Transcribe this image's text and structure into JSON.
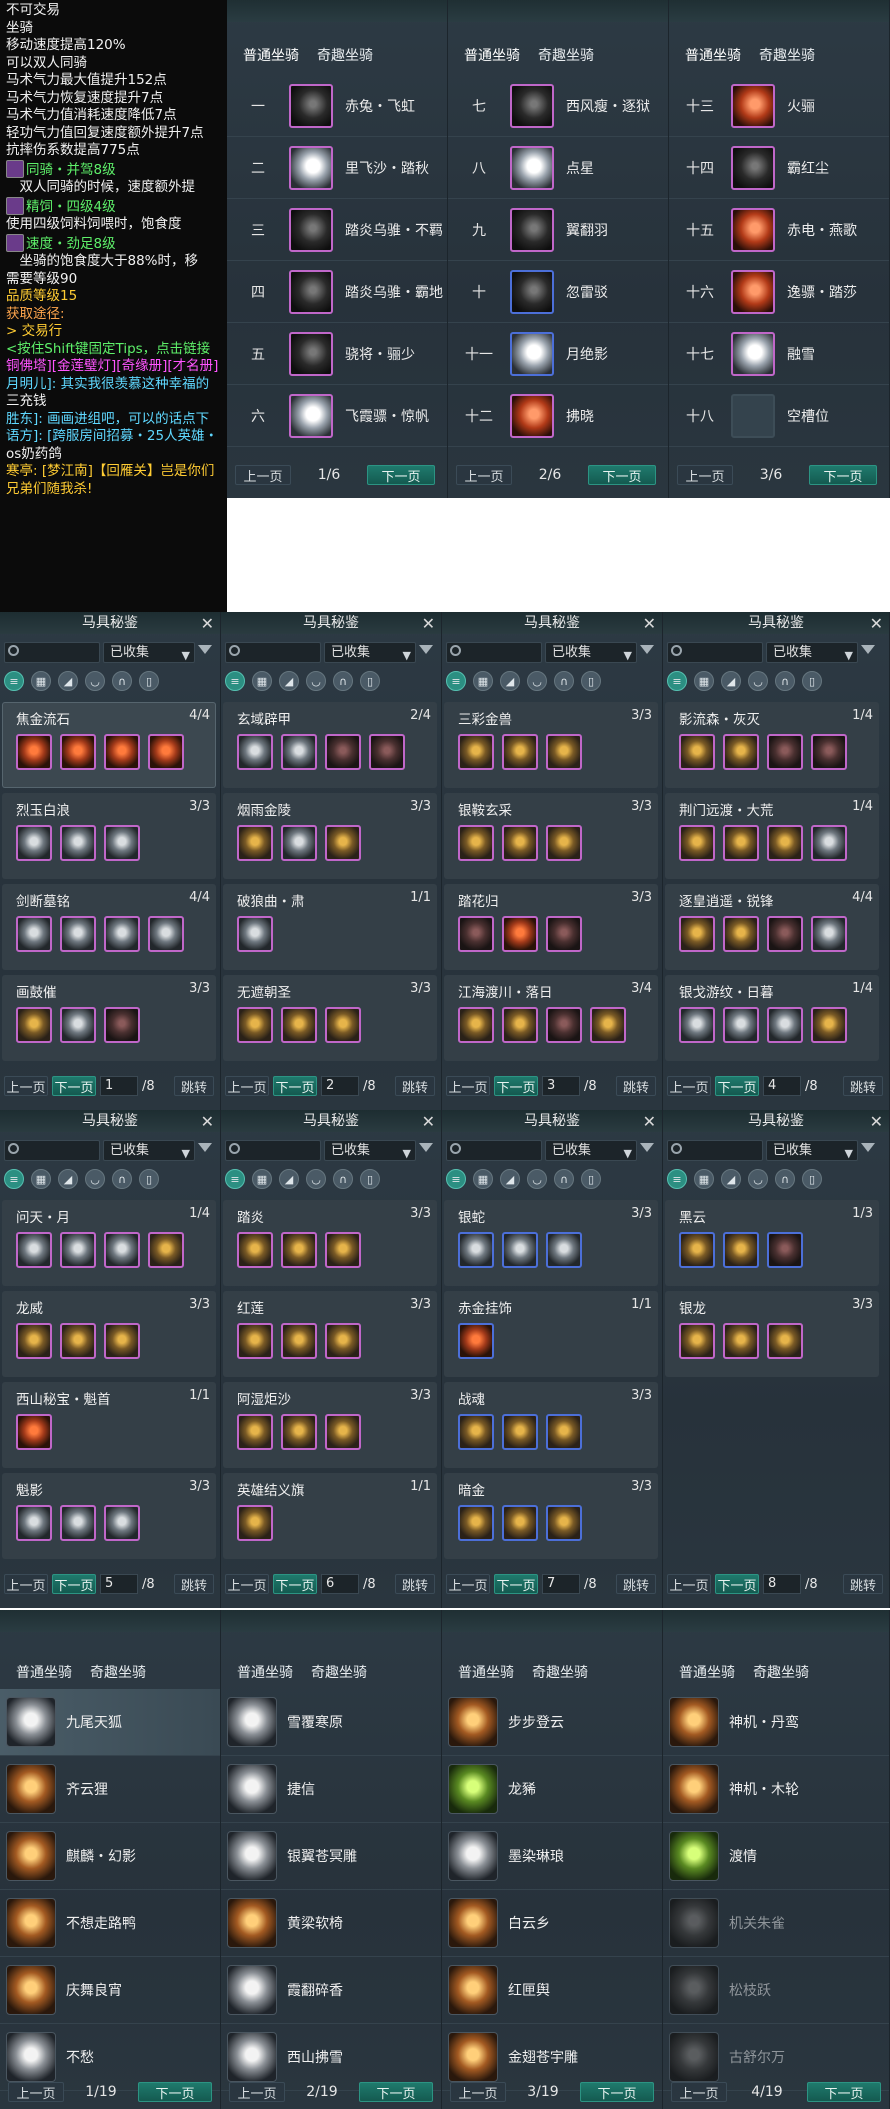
{
  "tooltip": {
    "lines": [
      {
        "text": "不可交易",
        "cls": "c-w"
      },
      {
        "text": "坐骑",
        "cls": "c-w"
      },
      {
        "text": "移动速度提高120%",
        "cls": "c-w"
      },
      {
        "text": "可以双人同骑",
        "cls": "c-w"
      },
      {
        "text": "马术气力最大值提升152点",
        "cls": "c-w"
      },
      {
        "text": "马术气力恢复速度提升7点",
        "cls": "c-w"
      },
      {
        "text": "马术气力值消耗速度降低7点",
        "cls": "c-w"
      },
      {
        "text": "轻功气力值回复速度额外提升7点",
        "cls": "c-w"
      },
      {
        "text": "抗摔伤系数提高775点",
        "cls": "c-w"
      },
      {
        "text": "同骑・并驾8级",
        "cls": "c-g",
        "icon": true
      },
      {
        "text": "　双人同骑的时候，速度额外提",
        "cls": "c-w"
      },
      {
        "text": "精饲・四级4级",
        "cls": "c-g",
        "icon": true
      },
      {
        "text": "使用四级饲料饲喂时，饱食度",
        "cls": "c-w"
      },
      {
        "text": "速度・劲足8级",
        "cls": "c-g",
        "icon": true
      },
      {
        "text": "　坐骑的饱食度大于88%时，移",
        "cls": "c-w"
      },
      {
        "text": "需要等级90",
        "cls": "c-w"
      },
      {
        "text": "品质等级15",
        "cls": "c-y"
      },
      {
        "text": "",
        "cls": "c-w"
      },
      {
        "text": "获取途径:",
        "cls": "c-o"
      },
      {
        "text": "> 交易行",
        "cls": "c-y"
      },
      {
        "text": "",
        "cls": "c-w"
      },
      {
        "text": "<按住Shift键固定Tips，点击链接",
        "cls": "c-g"
      },
      {
        "text": "铜佛塔][金莲璧灯][奇缘册][才名册]",
        "cls": "c-m"
      },
      {
        "text": "月明儿]: 其实我很羡慕这种幸福的",
        "cls": "c-c"
      },
      {
        "text": "三充钱",
        "cls": "c-w"
      },
      {
        "text": "胜东]: 画画进组吧，可以的话点下",
        "cls": "c-c"
      },
      {
        "text": "语方]: [跨服房间招募・25人英雄・",
        "cls": "c-c"
      },
      {
        "text": "os奶药鸽",
        "cls": "c-w"
      },
      {
        "text": "",
        "cls": "c-w"
      },
      {
        "text": "寒亭: [梦江南]【回雁关】岂是你们",
        "cls": "c-y"
      },
      {
        "text": "兄弟们随我杀!",
        "cls": "c-y"
      }
    ]
  },
  "top_mounts": {
    "tabs": [
      "普通坐骑",
      "奇趣坐骑"
    ],
    "prev": "上一页",
    "next": "下一页",
    "pages": [
      {
        "page": "1/6",
        "rows": [
          {
            "num": "一",
            "name": "赤兔・飞虹",
            "icon": "black"
          },
          {
            "num": "二",
            "name": "里飞沙・踏秋",
            "icon": "white"
          },
          {
            "num": "三",
            "name": "踏炎乌骓・不羁",
            "icon": "black"
          },
          {
            "num": "四",
            "name": "踏炎乌骓・霸地",
            "icon": "black"
          },
          {
            "num": "五",
            "name": "骁将・骊少",
            "icon": "black"
          },
          {
            "num": "六",
            "name": "飞霞骠・惊帆",
            "icon": "white"
          }
        ]
      },
      {
        "page": "2/6",
        "rows": [
          {
            "num": "七",
            "name": "西风瘦・逐狱",
            "icon": "black"
          },
          {
            "num": "八",
            "name": "点星",
            "icon": "white"
          },
          {
            "num": "九",
            "name": "翼翻羽",
            "icon": "black"
          },
          {
            "num": "十",
            "name": "忽雷驳",
            "icon": "black",
            "blue": true
          },
          {
            "num": "十一",
            "name": "月绝影",
            "icon": "white",
            "blue": true
          },
          {
            "num": "十二",
            "name": "拂晓",
            "icon": "red"
          }
        ]
      },
      {
        "page": "3/6",
        "rows": [
          {
            "num": "十三",
            "name": "火骊",
            "icon": "red"
          },
          {
            "num": "十四",
            "name": "霸红尘",
            "icon": "black"
          },
          {
            "num": "十五",
            "name": "赤电・燕歌",
            "icon": "red"
          },
          {
            "num": "十六",
            "name": "逸骠・踏莎",
            "icon": "red"
          },
          {
            "num": "十七",
            "name": "融雪",
            "icon": "white"
          },
          {
            "num": "十八",
            "name": "空槽位",
            "icon": "empty"
          }
        ]
      }
    ]
  },
  "saddle_panels": {
    "title": "马具秘鉴",
    "filter": "已收集",
    "prev": "上一页",
    "next": "下一页",
    "jump": "跳转",
    "total": "/8",
    "panels": [
      {
        "page": "1",
        "sets": [
          {
            "name": "焦金流石",
            "count": "4/4",
            "items": [
              "red",
              "red",
              "red",
              "red"
            ],
            "sel": true
          },
          {
            "name": "烈玉白浪",
            "count": "3/3",
            "items": [
              "gray",
              "gray",
              "gray"
            ]
          },
          {
            "name": "剑断墓铭",
            "count": "4/4",
            "items": [
              "gray",
              "gray",
              "gray",
              "gray"
            ]
          },
          {
            "name": "画鼓催",
            "count": "3/3",
            "items": [
              "gold",
              "gray",
              "dark"
            ]
          }
        ]
      },
      {
        "page": "2",
        "sets": [
          {
            "name": "玄域辟甲",
            "count": "2/4",
            "items": [
              "gray",
              "gray",
              "dark",
              "dark"
            ]
          },
          {
            "name": "烟雨金陵",
            "count": "3/3",
            "items": [
              "gold",
              "gray",
              "gold"
            ]
          },
          {
            "name": "破狼曲・肃",
            "count": "1/1",
            "items": [
              "gray"
            ]
          },
          {
            "name": "无遮朝圣",
            "count": "3/3",
            "items": [
              "gold",
              "gold",
              "gold"
            ]
          }
        ]
      },
      {
        "page": "3",
        "sets": [
          {
            "name": "三彩金兽",
            "count": "3/3",
            "items": [
              "gold",
              "gold",
              "gold"
            ]
          },
          {
            "name": "银鞍玄采",
            "count": "3/3",
            "items": [
              "gold",
              "gold",
              "gold"
            ]
          },
          {
            "name": "踏花归",
            "count": "3/3",
            "items": [
              "dark",
              "red",
              "dark"
            ]
          },
          {
            "name": "江海渡川・落日",
            "count": "3/4",
            "items": [
              "gold",
              "gold",
              "dark",
              "gold"
            ]
          }
        ]
      },
      {
        "page": "4",
        "sets": [
          {
            "name": "影流森・灰灭",
            "count": "1/4",
            "items": [
              "gold",
              "gold",
              "dark",
              "dark"
            ]
          },
          {
            "name": "荆门远渡・大荒",
            "count": "1/4",
            "items": [
              "gold",
              "gold",
              "gold",
              "gray"
            ]
          },
          {
            "name": "逐皇逍遥・锐锋",
            "count": "4/4",
            "items": [
              "gold",
              "gold",
              "dark",
              "gray"
            ]
          },
          {
            "name": "银戈游纹・日暮",
            "count": "1/4",
            "items": [
              "gray",
              "gray",
              "gray",
              "gold"
            ]
          }
        ]
      },
      {
        "page": "5",
        "sets": [
          {
            "name": "问天・月",
            "count": "1/4",
            "items": [
              "gray",
              "gray",
              "gray",
              "gold"
            ]
          },
          {
            "name": "龙威",
            "count": "3/3",
            "items": [
              "gold",
              "gold",
              "gold"
            ]
          },
          {
            "name": "西山秘宝・魁首",
            "count": "1/1",
            "items": [
              "red"
            ]
          },
          {
            "name": "魁影",
            "count": "3/3",
            "items": [
              "gray",
              "gray",
              "gray"
            ]
          }
        ]
      },
      {
        "page": "6",
        "sets": [
          {
            "name": "踏炎",
            "count": "3/3",
            "items": [
              "gold",
              "gold",
              "gold"
            ]
          },
          {
            "name": "红莲",
            "count": "3/3",
            "items": [
              "gold",
              "gold",
              "gold"
            ]
          },
          {
            "name": "阿湿炬沙",
            "count": "3/3",
            "items": [
              "gold",
              "gold",
              "gold"
            ]
          },
          {
            "name": "英雄结义旗",
            "count": "1/1",
            "items": [
              "gold"
            ]
          }
        ]
      },
      {
        "page": "7",
        "sets": [
          {
            "name": "银蛇",
            "count": "3/3",
            "items": [
              "gray",
              "gray",
              "gray"
            ],
            "blue": true
          },
          {
            "name": "赤金挂饰",
            "count": "1/1",
            "items": [
              "red"
            ],
            "blue": true
          },
          {
            "name": "战魂",
            "count": "3/3",
            "items": [
              "gold",
              "gold",
              "gold"
            ],
            "blue": true
          },
          {
            "name": "暗金",
            "count": "3/3",
            "items": [
              "gold",
              "gold",
              "gold"
            ],
            "blue": true
          }
        ]
      },
      {
        "page": "8",
        "sets": [
          {
            "name": "黑云",
            "count": "1/3",
            "items": [
              "gold",
              "gold",
              "dark"
            ],
            "blue": true
          },
          {
            "name": "银龙",
            "count": "3/3",
            "items": [
              "gold",
              "gold",
              "gold"
            ]
          }
        ]
      }
    ]
  },
  "bottom_mounts": {
    "tabs": [
      "普通坐骑",
      "奇趣坐骑"
    ],
    "prev": "上一页",
    "next": "下一页",
    "pages": [
      {
        "page": "1/19",
        "rows": [
          {
            "name": "九尾天狐",
            "icon": "white",
            "sel": true
          },
          {
            "name": "齐云狸",
            "icon": "warm"
          },
          {
            "name": "麒麟・幻影",
            "icon": "warm"
          },
          {
            "name": "不想走路鸭",
            "icon": "warm"
          },
          {
            "name": "庆舞良宵",
            "icon": "warm"
          },
          {
            "name": "不愁",
            "icon": "white"
          }
        ]
      },
      {
        "page": "2/19",
        "rows": [
          {
            "name": "雪覆寒原",
            "icon": "white"
          },
          {
            "name": "捷信",
            "icon": "white"
          },
          {
            "name": "银翼苍冥雕",
            "icon": "white"
          },
          {
            "name": "黄梁软椅",
            "icon": "warm"
          },
          {
            "name": "霞翻碎香",
            "icon": "white"
          },
          {
            "name": "西山拂雪",
            "icon": "white"
          }
        ]
      },
      {
        "page": "3/19",
        "rows": [
          {
            "name": "步步登云",
            "icon": "warm"
          },
          {
            "name": "龙豨",
            "icon": "green"
          },
          {
            "name": "墨染琳琅",
            "icon": "white"
          },
          {
            "name": "白云乡",
            "icon": "warm"
          },
          {
            "name": "红匣舆",
            "icon": "warm"
          },
          {
            "name": "金翅苍宇雕",
            "icon": "warm"
          }
        ]
      },
      {
        "page": "4/19",
        "rows": [
          {
            "name": "神机・丹鸾",
            "icon": "warm"
          },
          {
            "name": "神机・木轮",
            "icon": "warm"
          },
          {
            "name": "渡情",
            "icon": "green"
          },
          {
            "name": "机关朱雀",
            "icon": "grey",
            "dim": true
          },
          {
            "name": "松枝跃",
            "icon": "grey",
            "dim": true
          },
          {
            "name": "古舒尔万",
            "icon": "grey",
            "dim": true
          }
        ]
      }
    ]
  }
}
